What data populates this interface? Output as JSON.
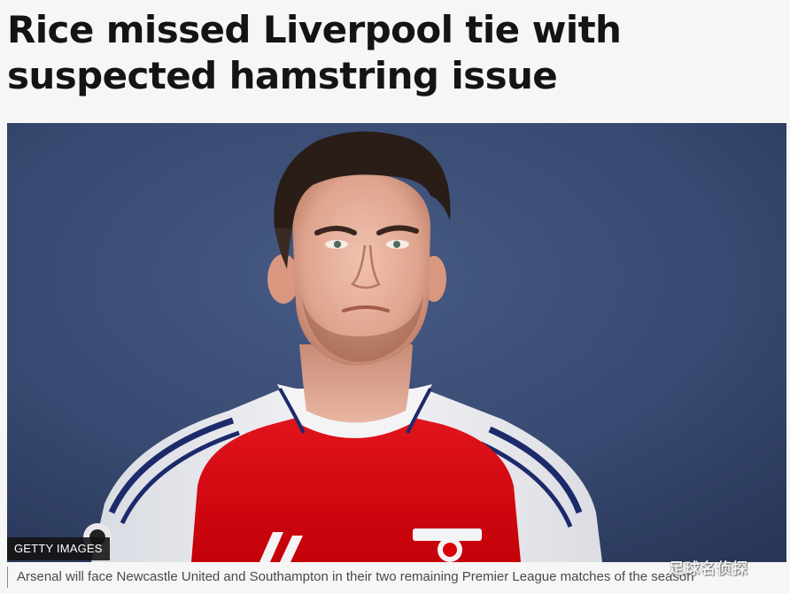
{
  "article": {
    "headline_line1": "Rice missed Liverpool tie with",
    "headline_line2": "suspected hamstring issue"
  },
  "image": {
    "credit": "GETTY IMAGES",
    "caption": "Arsenal will face Newcastle United and Southampton in their two remaining Premier League matches of the season"
  },
  "watermark": "足球名侦探",
  "colors": {
    "background": "#3e5178",
    "shirt_red": "#db0007",
    "shirt_white": "#f1f1f3",
    "trim_navy": "#1c2a6b"
  }
}
